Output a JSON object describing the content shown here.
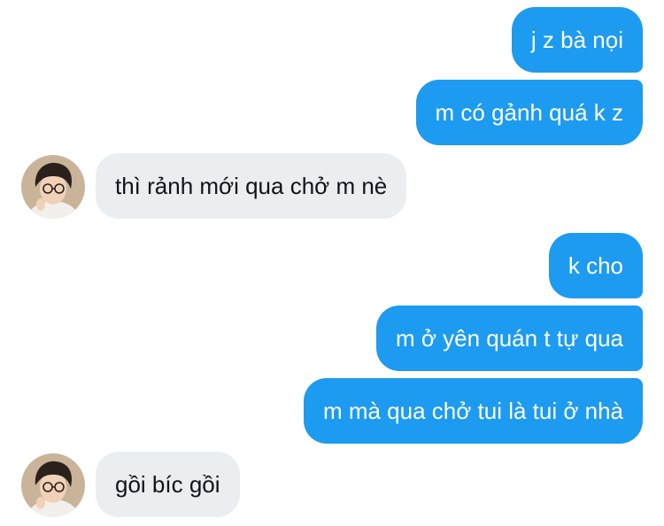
{
  "conversation": {
    "messages": [
      {
        "direction": "outgoing",
        "text": "j z bà nọi"
      },
      {
        "direction": "outgoing",
        "text": "m có gảnh quá k z"
      },
      {
        "direction": "incoming",
        "text": "thì rảnh mới qua chở m nè",
        "avatar": "contact-avatar"
      },
      {
        "direction": "outgoing",
        "text": "k cho"
      },
      {
        "direction": "outgoing",
        "text": "m ở yên quán t tự qua"
      },
      {
        "direction": "outgoing",
        "text": "m mà qua chở tui là tui ở nhà"
      },
      {
        "direction": "incoming",
        "text": "gồi bíc gồi",
        "avatar": "contact-avatar"
      }
    ]
  },
  "colors": {
    "outgoing_bubble": "#1d9bf0",
    "outgoing_text": "#ffffff",
    "incoming_bubble": "#ebeef0",
    "incoming_text": "#0f1419",
    "background": "#ffffff"
  }
}
